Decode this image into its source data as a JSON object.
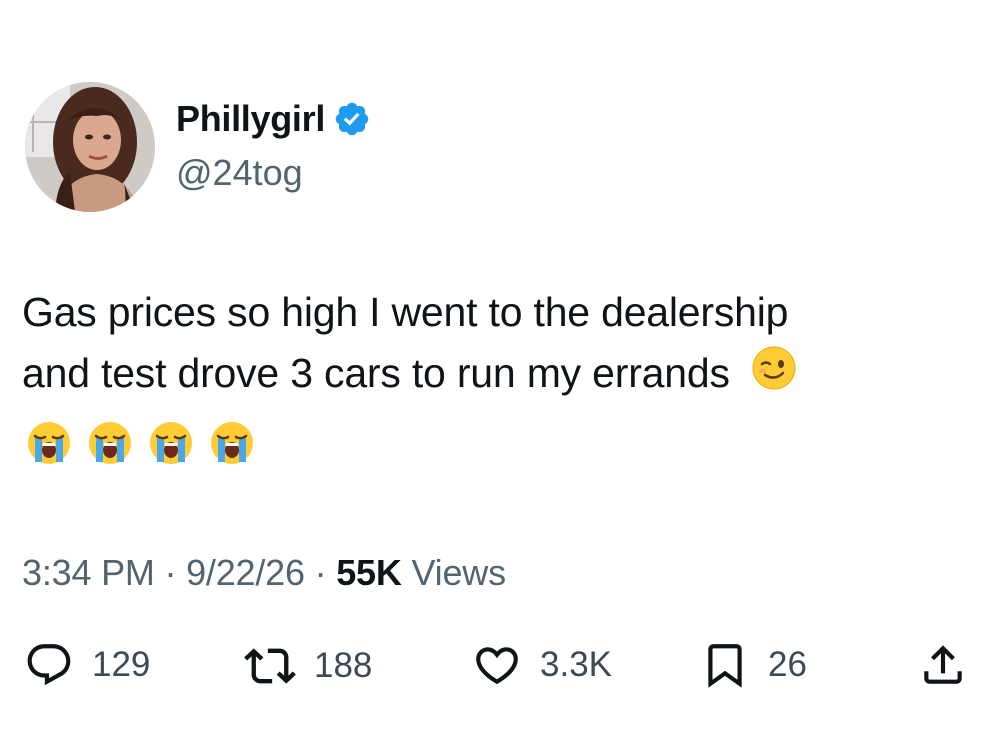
{
  "author": {
    "display_name": "Phillygirl",
    "handle": "@24tog",
    "verified_icon": "verified-badge-icon"
  },
  "tweet": {
    "text_line1": "Gas prices so high I went to the dealership",
    "text_line2": "and test drove 3 cars to run my errands",
    "emojis": [
      "winking-face-emoji",
      "loudly-crying-face-emoji",
      "loudly-crying-face-emoji",
      "loudly-crying-face-emoji",
      "loudly-crying-face-emoji"
    ]
  },
  "meta": {
    "time": "3:34 PM",
    "separator": "·",
    "date": "9/22/26",
    "views_count": "55K",
    "views_label": "Views"
  },
  "actions": {
    "replies": "129",
    "reposts": "188",
    "likes": "3.3K",
    "bookmarks": "26"
  },
  "colors": {
    "verified": "#1d9bf0",
    "secondary_text": "#536471",
    "primary_text": "#0f1419"
  }
}
